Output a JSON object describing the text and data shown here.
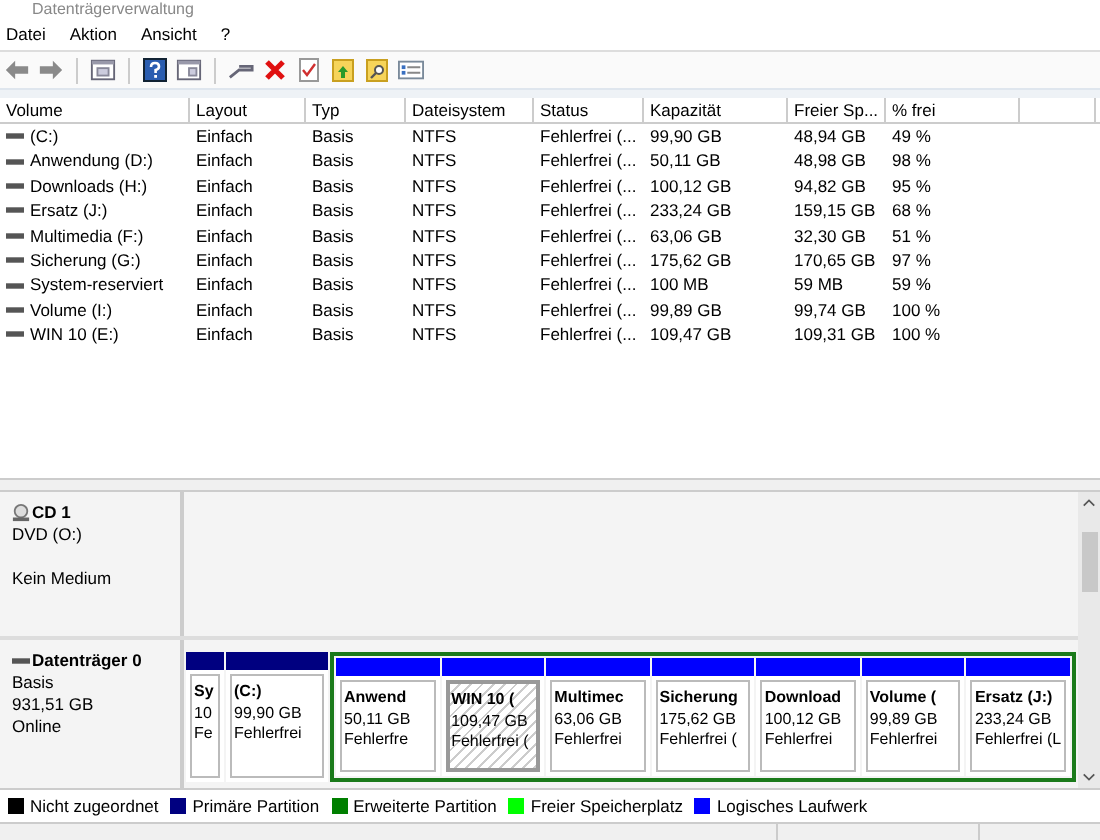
{
  "window": {
    "title": "Datenträgerverwaltung"
  },
  "menu": [
    "Datei",
    "Aktion",
    "Ansicht",
    "?"
  ],
  "table": {
    "columns": [
      "Volume",
      "Layout",
      "Typ",
      "Dateisystem",
      "Status",
      "Kapazität",
      "Freier Sp...",
      "% frei"
    ],
    "rows": [
      [
        "(C:)",
        "Einfach",
        "Basis",
        "NTFS",
        "Fehlerfrei (...",
        "99,90 GB",
        "48,94 GB",
        "49 %"
      ],
      [
        "Anwendung (D:)",
        "Einfach",
        "Basis",
        "NTFS",
        "Fehlerfrei (...",
        "50,11 GB",
        "48,98 GB",
        "98 %"
      ],
      [
        "Downloads (H:)",
        "Einfach",
        "Basis",
        "NTFS",
        "Fehlerfrei (...",
        "100,12 GB",
        "94,82 GB",
        "95 %"
      ],
      [
        "Ersatz (J:)",
        "Einfach",
        "Basis",
        "NTFS",
        "Fehlerfrei (...",
        "233,24 GB",
        "159,15 GB",
        "68 %"
      ],
      [
        "Multimedia (F:)",
        "Einfach",
        "Basis",
        "NTFS",
        "Fehlerfrei (...",
        "63,06 GB",
        "32,30 GB",
        "51 %"
      ],
      [
        "Sicherung (G:)",
        "Einfach",
        "Basis",
        "NTFS",
        "Fehlerfrei (...",
        "175,62 GB",
        "170,65 GB",
        "97 %"
      ],
      [
        "System-reserviert",
        "Einfach",
        "Basis",
        "NTFS",
        "Fehlerfrei (...",
        "100 MB",
        "59 MB",
        "59 %"
      ],
      [
        "Volume (I:)",
        "Einfach",
        "Basis",
        "NTFS",
        "Fehlerfrei (...",
        "99,89 GB",
        "99,74 GB",
        "100 %"
      ],
      [
        "WIN 10 (E:)",
        "Einfach",
        "Basis",
        "NTFS",
        "Fehlerfrei (...",
        "109,47 GB",
        "109,31 GB",
        "100 %"
      ]
    ]
  },
  "cd": {
    "name": "CD 1",
    "drive": "DVD (O:)",
    "media": "Kein Medium"
  },
  "disk": {
    "name": "Datenträger 0",
    "type": "Basis",
    "size": "931,51 GB",
    "status": "Online",
    "partitions": [
      {
        "kind": "primary",
        "lines": [
          "Sy",
          "10",
          "Fe"
        ],
        "selected": false
      },
      {
        "kind": "primary",
        "lines": [
          "(C:)",
          "99,90 GB",
          "Fehlerfrei"
        ],
        "selected": false
      },
      {
        "kind": "extended",
        "drives": [
          {
            "lines": [
              "Anwend",
              "50,11 GB",
              "Fehlerfre"
            ],
            "selected": false
          },
          {
            "lines": [
              "WIN 10 (",
              "109,47 GB",
              "Fehlerfrei ("
            ],
            "selected": true
          },
          {
            "lines": [
              "Multimec",
              "63,06 GB",
              "Fehlerfrei"
            ],
            "selected": false
          },
          {
            "lines": [
              "Sicherung",
              "175,62 GB",
              "Fehlerfrei ("
            ],
            "selected": false
          },
          {
            "lines": [
              "Download",
              "100,12 GB",
              "Fehlerfrei"
            ],
            "selected": false
          },
          {
            "lines": [
              "Volume (",
              "99,89 GB",
              "Fehlerfrei"
            ],
            "selected": false
          },
          {
            "lines": [
              "Ersatz (J:)",
              "233,24 GB",
              "Fehlerfrei (L"
            ],
            "selected": false
          }
        ]
      }
    ]
  },
  "legend": [
    {
      "label": "Nicht zugeordnet",
      "color": "#000000"
    },
    {
      "label": "Primäre Partition",
      "color": "#000080"
    },
    {
      "label": "Erweiterte Partition",
      "color": "#007f00"
    },
    {
      "label": "Freier Speicherplatz",
      "color": "#00ff00"
    },
    {
      "label": "Logisches Laufwerk",
      "color": "#0000ff"
    }
  ]
}
